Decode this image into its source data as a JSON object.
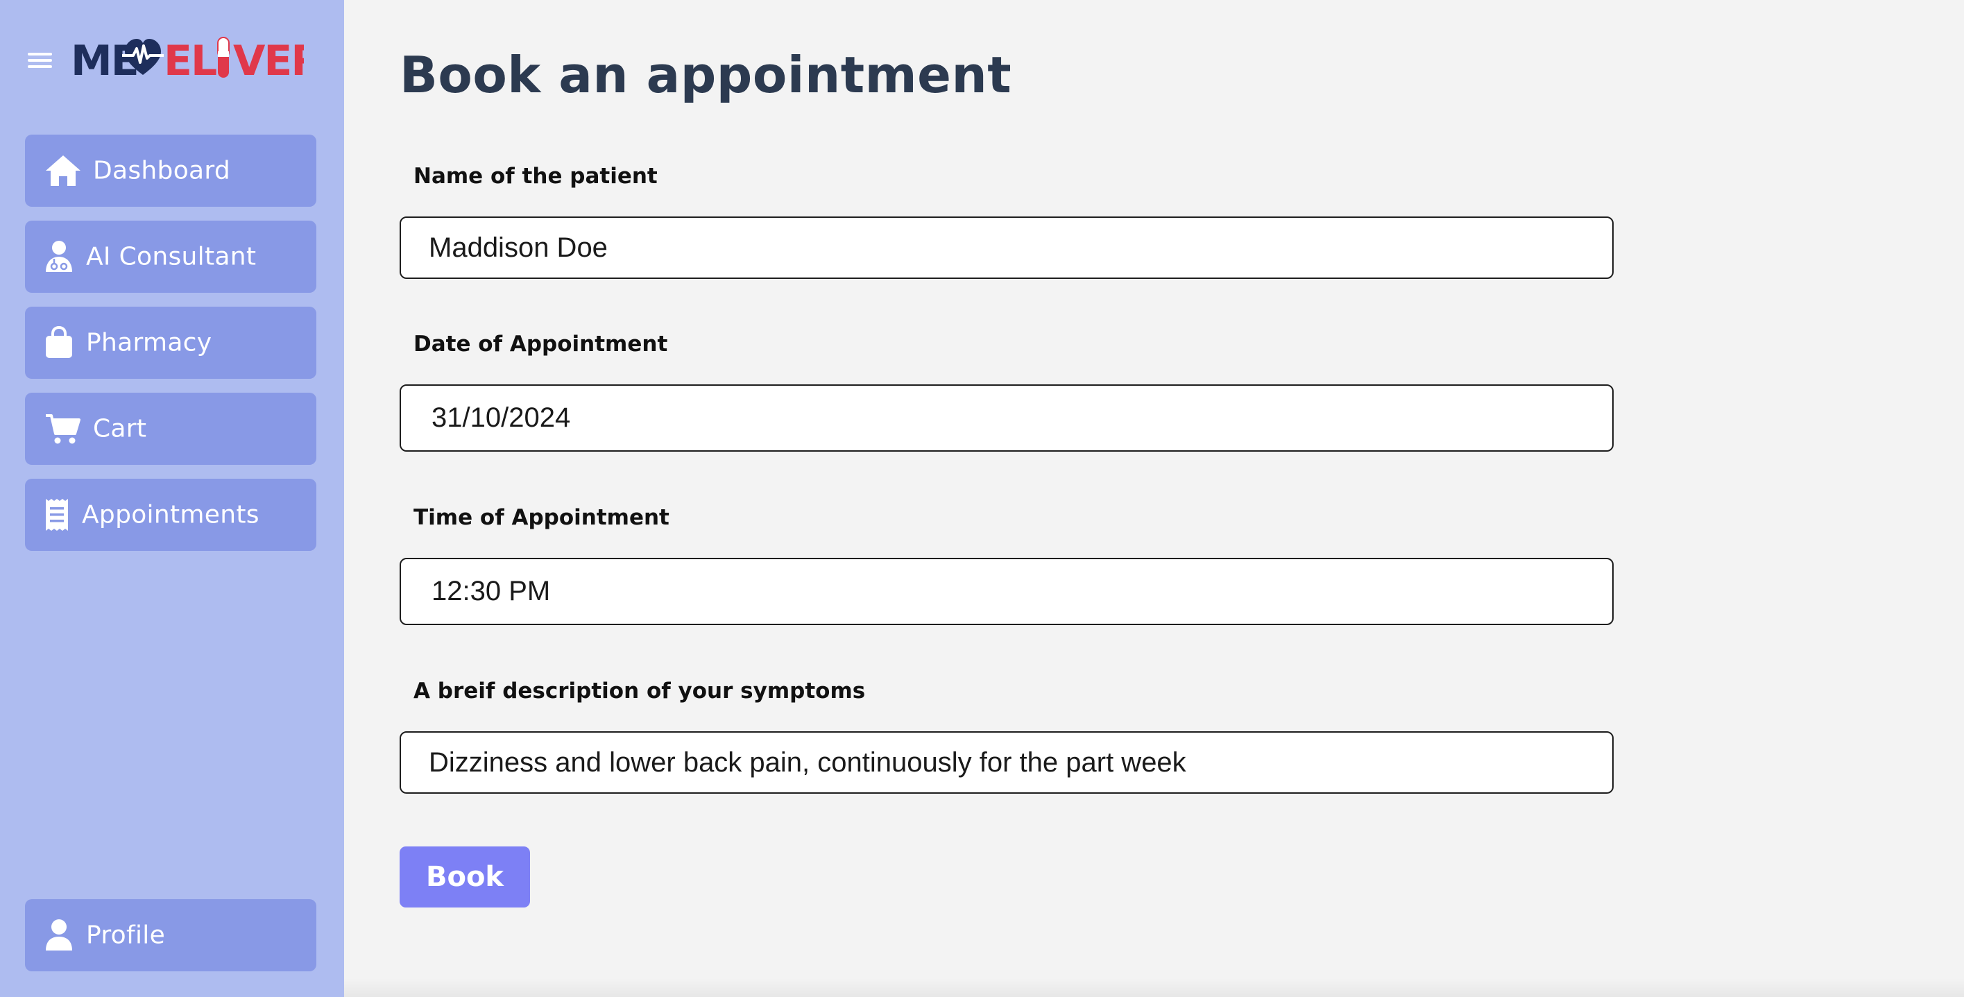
{
  "brand": {
    "logo_text": "MEDELIVER",
    "colors": {
      "navy": "#1e2e5c",
      "red": "#e0384a"
    }
  },
  "sidebar": {
    "menu_icon": "hamburger-icon",
    "items": [
      {
        "label": "Dashboard",
        "icon": "home-icon"
      },
      {
        "label": "AI Consultant",
        "icon": "doctor-icon"
      },
      {
        "label": "Pharmacy",
        "icon": "shopping-bag-icon"
      },
      {
        "label": "Cart",
        "icon": "cart-icon"
      },
      {
        "label": "Appointments",
        "icon": "receipt-icon"
      }
    ],
    "profile": {
      "label": "Profile",
      "icon": "user-icon"
    }
  },
  "main": {
    "title": "Book an appointment",
    "fields": [
      {
        "label": "Name of the patient",
        "value": "Maddison Doe"
      },
      {
        "label": "Date of Appointment",
        "value": "31/10/2024"
      },
      {
        "label": "Time of Appointment",
        "value": "12:30 PM"
      },
      {
        "label": "A breif description of your symptoms",
        "value": "Dizziness and lower back pain, continuously for the part week"
      }
    ],
    "submit_label": "Book"
  },
  "theme": {
    "sidebar_bg": "#aebcf0",
    "nav_item_bg": "#8899e6",
    "button_bg": "#7d80f5",
    "title_color": "#2c3a50",
    "page_bg": "#f3f3f3"
  }
}
